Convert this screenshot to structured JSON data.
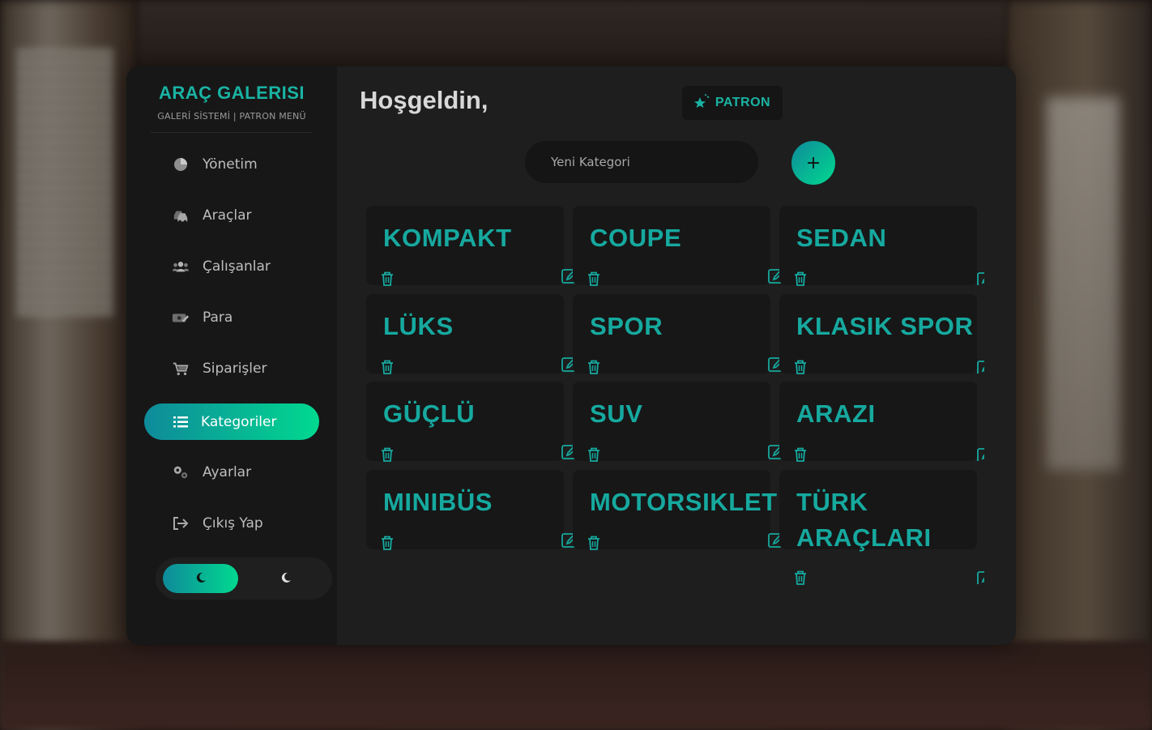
{
  "brand": {
    "title": "ARAÇ GALERISI",
    "subtitle": "GALERİ SİSTEMİ | PATRON MENÜ"
  },
  "nav": [
    {
      "label": "Yönetim",
      "icon": "pie-chart-icon"
    },
    {
      "label": "Araçlar",
      "icon": "cars-icon"
    },
    {
      "label": "Çalışanlar",
      "icon": "users-icon"
    },
    {
      "label": "Para",
      "icon": "money-icon"
    },
    {
      "label": "Siparişler",
      "icon": "cart-icon"
    },
    {
      "label": "Kategoriler",
      "icon": "list-icon",
      "active": true
    },
    {
      "label": "Ayarlar",
      "icon": "gears-icon"
    },
    {
      "label": "Çıkış Yap",
      "icon": "logout-icon"
    }
  ],
  "theme_toggle": {
    "selected": "dark",
    "icons": [
      "moon-icon",
      "moon-icon"
    ]
  },
  "header": {
    "welcome": "Hoşgeldin,",
    "role": "PATRON"
  },
  "new_category": {
    "placeholder": "Yeni Kategori",
    "value": "",
    "add_label": "+"
  },
  "categories": [
    "KOMPAKT",
    "COUPE",
    "SEDAN",
    "LÜKS",
    "SPOR",
    "KLASIK SPOR",
    "GÜÇLÜ",
    "SUV",
    "ARAZI",
    "MINIBÜS",
    "MOTORSIKLET",
    "TÜRK ARAÇLARI"
  ],
  "colors": {
    "accent": "#16a99f",
    "gradient_start": "#0f8a9a",
    "gradient_end": "#00d98f",
    "panel": "#1c1c1c"
  }
}
